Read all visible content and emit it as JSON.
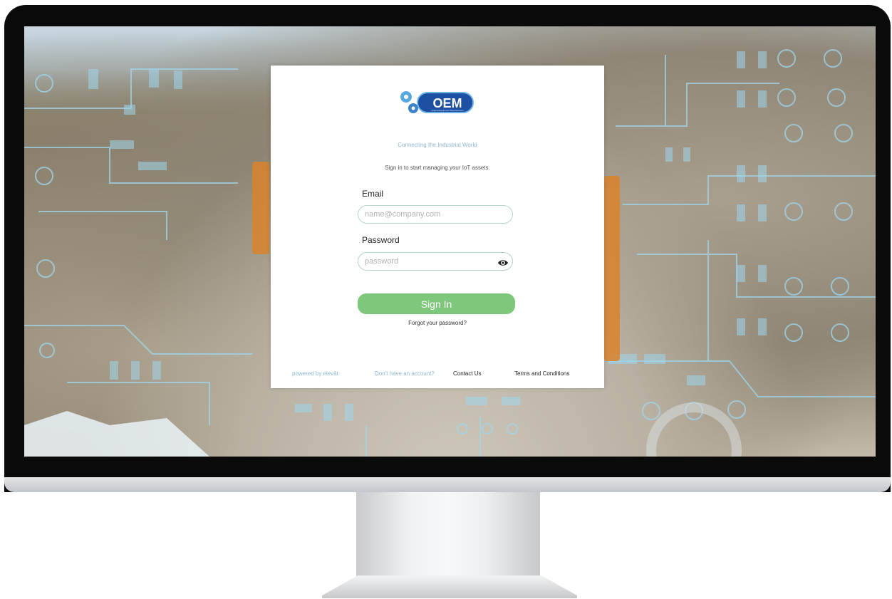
{
  "brand": {
    "logo_text": "OEM",
    "logo_subtext": "Original Equipment Manufacturers",
    "tagline": "Connecting the Industrial World"
  },
  "login": {
    "subtitle": "Sign in to start managing your IoT assets.",
    "email_label": "Email",
    "email_placeholder": "name@company.com",
    "password_label": "Password",
    "password_placeholder": "password",
    "password_toggle_icon": "eye-icon",
    "sign_in_label": "Sign In",
    "forgot_label": "Forgot your password?"
  },
  "footer": {
    "powered_by": "powered by elevāt",
    "no_account": "Don't have an account?",
    "contact_label": "Contact Us",
    "terms_label": "Terms and Conditions"
  },
  "colors": {
    "accent_green": "#7fc77a",
    "brand_blue": "#1d4fa3",
    "muted_blue_text": "#8fb7d3"
  }
}
